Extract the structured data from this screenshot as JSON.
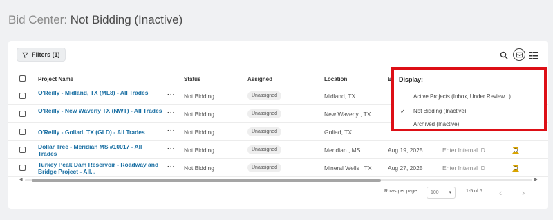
{
  "page": {
    "title_prefix": "Bid Center:",
    "title_view": "Not Bidding (Inactive)"
  },
  "toolbar": {
    "filters_label": "Filters (1)"
  },
  "table": {
    "columns": {
      "project_name": "Project Name",
      "status": "Status",
      "assigned": "Assigned",
      "location": "Location",
      "bid_date": "B"
    },
    "more_glyph": "···",
    "rows": [
      {
        "project": "O'Reilly - Midland, TX (ML8) - All Trades",
        "status": "Not Bidding",
        "assigned": "Unassigned",
        "location": "Midland, TX",
        "bid_date": "",
        "internal_id": ""
      },
      {
        "project": "O'Reilly - New Waverly TX (NWT) - All Trades",
        "status": "Not Bidding",
        "assigned": "Unassigned",
        "location": "New Waverly , TX",
        "bid_date": "",
        "internal_id": ""
      },
      {
        "project": "O'Reilly - Goliad, TX (GLD) - All Trades",
        "status": "Not Bidding",
        "assigned": "Unassigned",
        "location": "Goliad, TX",
        "bid_date": "",
        "internal_id": ""
      },
      {
        "project": "Dollar Tree - Meridian MS #10017 - All Trades",
        "status": "Not Bidding",
        "assigned": "Unassigned",
        "location": "Meridian , MS",
        "bid_date": "Aug 19, 2025",
        "internal_id": "Enter Internal ID"
      },
      {
        "project": "Turkey Peak Dam Reservoir - Roadway and Bridge Project - All...",
        "status": "Not Bidding",
        "assigned": "Unassigned",
        "location": "Mineral Wells , TX",
        "bid_date": "Aug 27, 2025",
        "internal_id": "Enter Internal ID"
      }
    ]
  },
  "pagination": {
    "rows_per_page_label": "Rows per page",
    "rows_per_page_value": "100",
    "range": "1-5 of 5"
  },
  "display_menu": {
    "title": "Display:",
    "options": [
      {
        "label": "Active Projects (Inbox, Under Review...)",
        "selected": false
      },
      {
        "label": "Not Bidding (Inactive)",
        "selected": true
      },
      {
        "label": "Archived (Inactive)",
        "selected": false
      }
    ],
    "check_glyph": "✓"
  },
  "colors": {
    "link": "#1a6fa3",
    "highlight_border": "#dd0f16",
    "warning_icon": "#d9a400"
  },
  "icons": [
    "filter-icon",
    "search-icon",
    "display-icon",
    "columns-icon",
    "warning-icon",
    "chevron-left-icon",
    "chevron-right-icon"
  ]
}
